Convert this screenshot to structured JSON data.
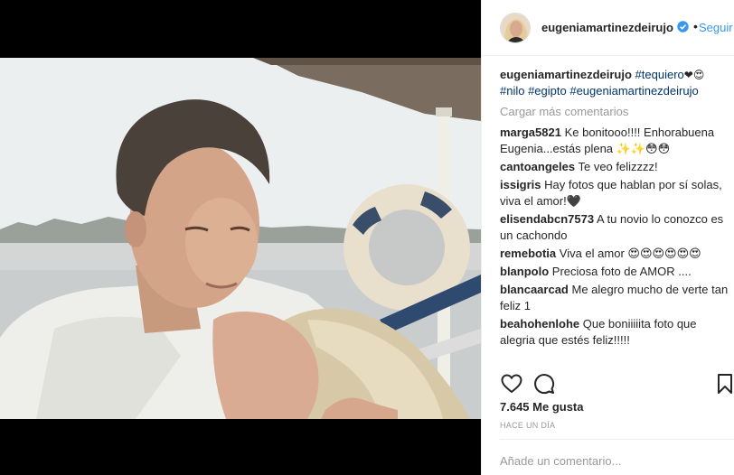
{
  "post": {
    "author": "eugeniamartinezdeirujo",
    "follow_label": "Seguir",
    "separator": "•",
    "caption_user": "eugeniamartinezdeirujo",
    "caption_tags": "#tequiero",
    "caption_emoji": "❤😍",
    "caption_tags2": "#nilo #egipto #eugeniamartinezdeirujo",
    "load_more": "Cargar más comentarios",
    "likes": "7.645 Me gusta",
    "time": "HACE UN DÍA",
    "add_comment_placeholder": "Añade un comentario..."
  },
  "comments": [
    {
      "user": "marga5821",
      "text": "Ke bonitooo!!!! Enhorabuena Eugenia...estás plena ✨✨😳😳"
    },
    {
      "user": "cantoangeles",
      "text": "Te veo felizzzz!"
    },
    {
      "user": "issigris",
      "text": "Hay fotos que hablan por sí solas, viva el amor!🖤"
    },
    {
      "user": "elisendabcn7573",
      "text": "A tu novio lo conozco es un cachondo"
    },
    {
      "user": "remebotia",
      "text": "Viva el amor 😍😍😍😍😍😍"
    },
    {
      "user": "blanpolo",
      "text": "Preciosa foto de AMOR ...."
    },
    {
      "user": "blancaarcad",
      "text": "Me alegro mucho de verte tan feliz 1"
    },
    {
      "user": "beahohenlohe",
      "text": "Que boniiiiita foto que alegria que estés feliz!!!!!"
    }
  ],
  "icons": {
    "like": "heart-outline-icon",
    "comment": "speech-bubble-icon",
    "save": "bookmark-icon",
    "verified": "verified-badge-icon"
  },
  "colors": {
    "link": "#3897f0",
    "hashtag": "#003569",
    "muted": "#999999",
    "text": "#262626",
    "media_bg": "#000000"
  }
}
